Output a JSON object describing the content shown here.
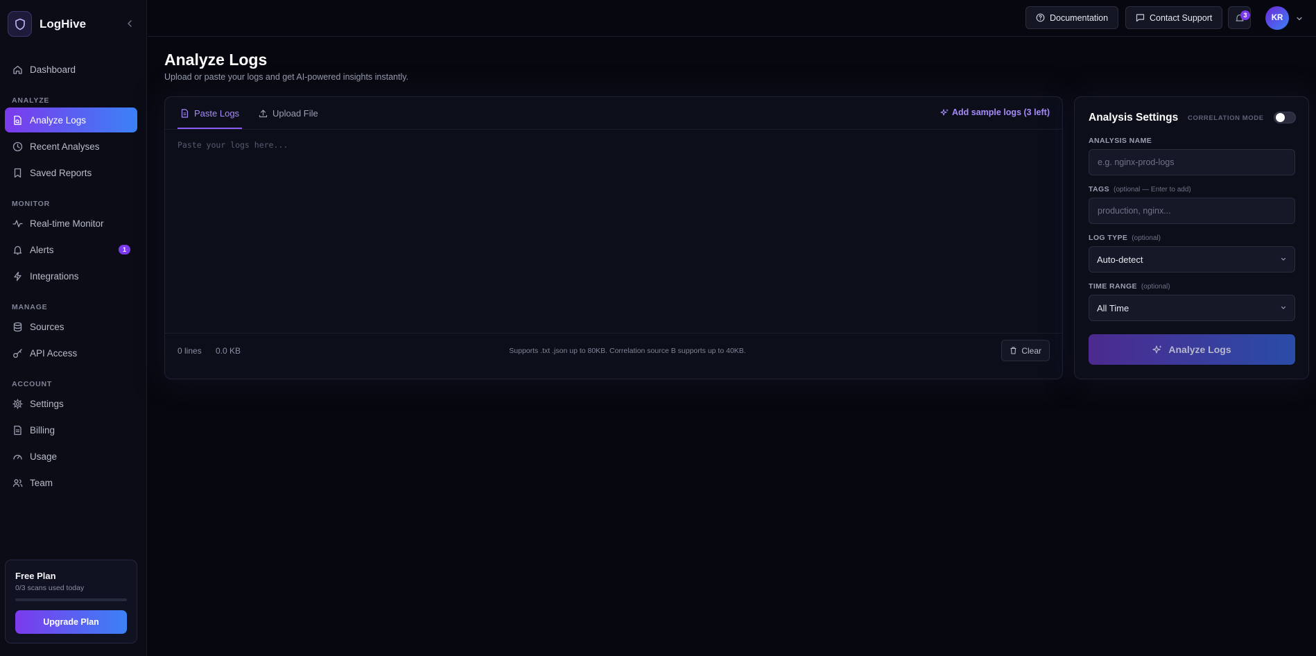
{
  "app": {
    "name": "LogHive"
  },
  "sidebar": {
    "top_items": [
      {
        "label": "Dashboard",
        "icon": "home-icon"
      }
    ],
    "sections": [
      {
        "label": "ANALYZE",
        "items": [
          {
            "label": "Analyze Logs",
            "icon": "file-search-icon",
            "active": true
          },
          {
            "label": "Recent Analyses",
            "icon": "clock-icon"
          },
          {
            "label": "Saved Reports",
            "icon": "bookmark-icon"
          }
        ]
      },
      {
        "label": "MONITOR",
        "items": [
          {
            "label": "Real-time Monitor",
            "icon": "activity-icon"
          },
          {
            "label": "Alerts",
            "icon": "bell-icon",
            "badge": "1"
          },
          {
            "label": "Integrations",
            "icon": "zap-icon"
          }
        ]
      },
      {
        "label": "MANAGE",
        "items": [
          {
            "label": "Sources",
            "icon": "database-icon"
          },
          {
            "label": "API Access",
            "icon": "key-icon"
          }
        ]
      },
      {
        "label": "ACCOUNT",
        "items": [
          {
            "label": "Settings",
            "icon": "gear-icon"
          },
          {
            "label": "Billing",
            "icon": "receipt-icon"
          },
          {
            "label": "Usage",
            "icon": "gauge-icon"
          },
          {
            "label": "Team",
            "icon": "users-icon"
          }
        ]
      }
    ],
    "plan": {
      "title": "Free Plan",
      "usage_text": "0/3 scans used today",
      "usage_fraction": 0,
      "upgrade_label": "Upgrade Plan"
    }
  },
  "topbar": {
    "documentation_label": "Documentation",
    "support_label": "Contact Support",
    "notification_count": "3",
    "avatar_initials": "KR"
  },
  "page": {
    "title": "Analyze Logs",
    "subtitle": "Upload or paste your logs and get AI-powered insights instantly."
  },
  "editor": {
    "tabs": [
      {
        "label": "Paste Logs",
        "icon": "file-text-icon",
        "active": true
      },
      {
        "label": "Upload File",
        "icon": "upload-icon"
      }
    ],
    "sample_label": "Add sample logs (3 left)",
    "placeholder": "Paste your logs here...",
    "value": "",
    "lines_label": "0 lines",
    "size_label": "0.0 KB",
    "support_note": "Supports .txt .json up to 80KB. Correlation source B supports up to 40KB.",
    "clear_label": "Clear"
  },
  "settings": {
    "title": "Analysis Settings",
    "correlation_label": "CORRELATION MODE",
    "correlation_enabled": false,
    "name_label": "ANALYSIS NAME",
    "name_placeholder": "e.g. nginx-prod-logs",
    "tags_label": "TAGS",
    "tags_hint": "(optional — Enter to add)",
    "tags_placeholder": "production, nginx...",
    "log_type_label": "LOG TYPE",
    "log_type_hint": "(optional)",
    "log_type_value": "Auto-detect",
    "time_range_label": "TIME RANGE",
    "time_range_hint": "(optional)",
    "time_range_value": "All Time",
    "analyze_label": "Analyze Logs"
  },
  "colors": {
    "background": "#07080f",
    "sidebar": "#0b0c16",
    "accent_purple": "#7c3aed",
    "accent_blue": "#3b82f6",
    "tab_active": "#a78bfa"
  }
}
